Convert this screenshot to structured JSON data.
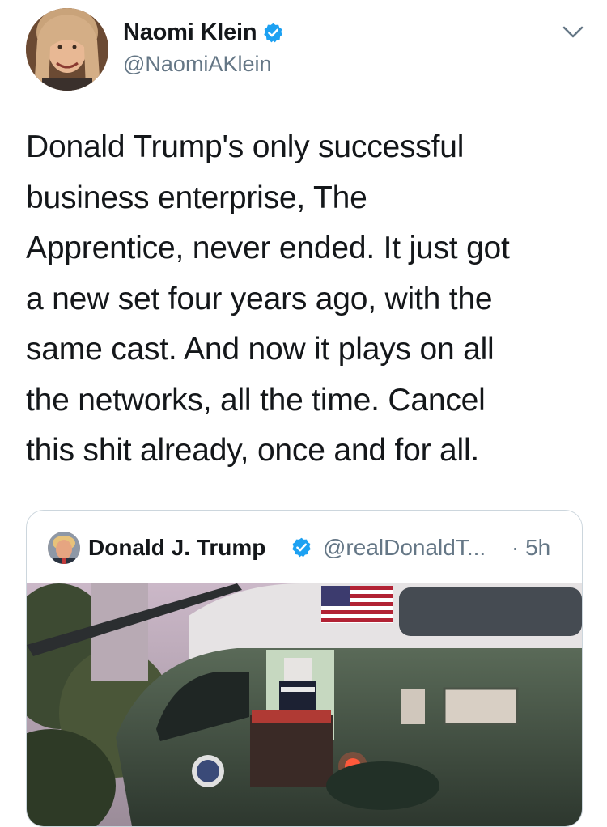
{
  "tweet": {
    "author": {
      "name": "Naomi Klein",
      "handle": "@NaomiAKlein",
      "verified": true
    },
    "menu_icon": "chevron-down-icon",
    "text_lines": [
      "Donald Trump's only successful",
      "business enterprise, The",
      "Apprentice, never ended. It just got",
      "a new set four years ago, with the",
      "same cast. And now it plays on all",
      "the networks, all the time. Cancel",
      "this shit already, once and for all."
    ]
  },
  "quoted_tweet": {
    "author": {
      "name": "Donald J. Trump",
      "handle": "@realDonaldT...",
      "verified": true
    },
    "time": "· 5h",
    "media_description_icon": "helicopter-photo"
  },
  "colors": {
    "text": "#14171a",
    "secondary": "#657786",
    "verified_blue": "#1da1f2",
    "border": "#ccd6dd"
  }
}
